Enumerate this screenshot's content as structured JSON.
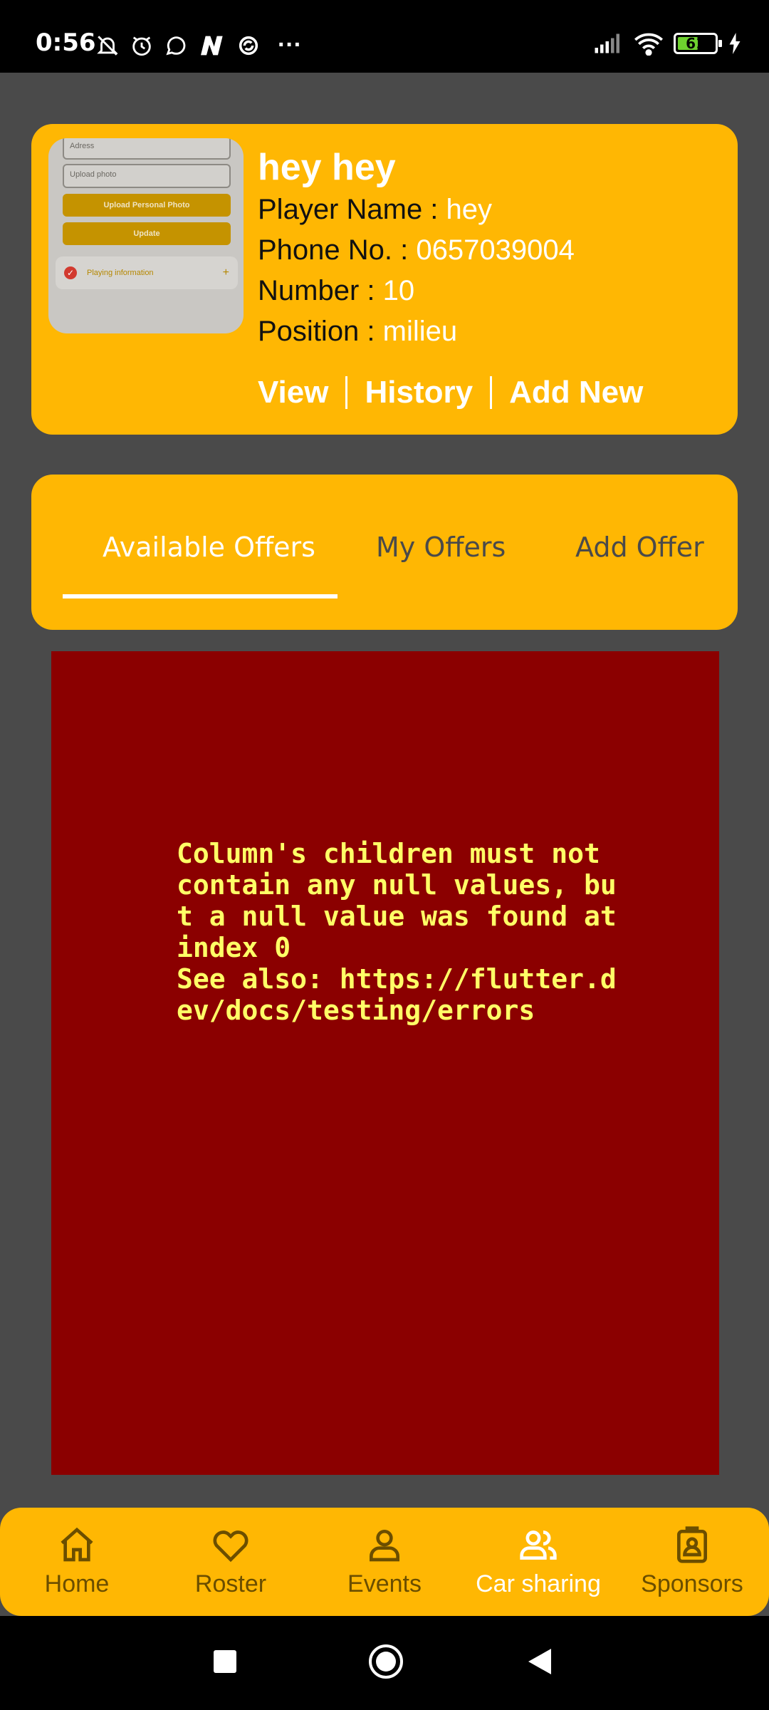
{
  "status_bar": {
    "time": "0:56",
    "more": "···",
    "battery_level": "61",
    "battery_fraction": 0.61,
    "battery_color": "#6ed12f"
  },
  "profile": {
    "thumb": {
      "address_placeholder": "Adress",
      "upload_placeholder": "Upload photo",
      "upload_button": "Upload Personal Photo",
      "update_button": "Update",
      "section_label": "Playing information",
      "check_icon": "✓",
      "plus_icon": "+"
    },
    "name": "hey hey",
    "player_name_label": "Player Name :",
    "player_name_value": "hey",
    "phone_label": "Phone No. :",
    "phone_value": "0657039004",
    "number_label": "Number :",
    "number_value": "10",
    "position_label": "Position :",
    "position_value": "milieu",
    "actions": {
      "view": "View",
      "history": "History",
      "add_new": "Add New"
    }
  },
  "tabs": {
    "available": "Available Offers",
    "my": "My Offers",
    "add": "Add Offer",
    "active": "available"
  },
  "error": {
    "message": "Column's children must not contain any null values, but a null value was found at index 0\nSee also: https://flutter.dev/docs/testing/errors"
  },
  "bottom_nav": {
    "items": [
      {
        "label": "Home",
        "icon": "home-icon"
      },
      {
        "label": "Roster",
        "icon": "heart-icon"
      },
      {
        "label": "Events",
        "icon": "person-icon"
      },
      {
        "label": "Car sharing",
        "icon": "group-icon"
      },
      {
        "label": "Sponsors",
        "icon": "badge-icon"
      }
    ],
    "active_index": 3
  },
  "colors": {
    "accent": "#ffb703",
    "background": "#4a4a4a",
    "error_bg": "#8b0000",
    "error_text": "#ffff66"
  }
}
